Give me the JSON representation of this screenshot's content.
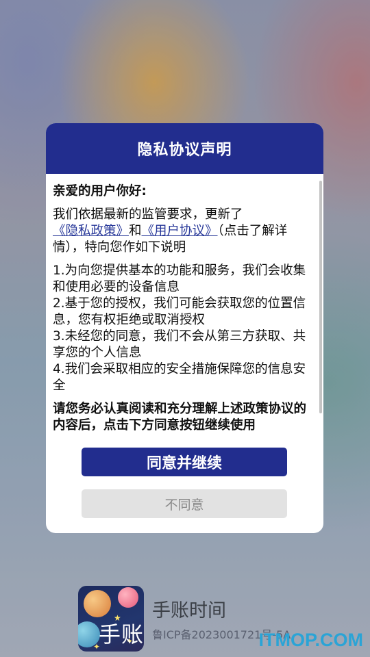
{
  "dialog": {
    "title": "隐私协议声明",
    "greeting": "亲爱的用户你好:",
    "intro_prefix": "我们依据最新的监管要求，更新了",
    "privacy_link": "《隐私政策》",
    "and": "和",
    "user_agreement_link": "《用户协议》",
    "intro_suffix": "（点击了解详情），特向您作如下说明",
    "points": [
      "1.为向您提供基本的功能和服务，我们会收集和使用必要的设备信息",
      " 2.基于您的授权，我们可能会获取您的位置信息，您有权拒绝或取消授权",
      " 3.未经您的同意，我们不会从第三方获取、共享您的个人信息",
      " 4.我们会采取相应的安全措施保障您的信息安全"
    ],
    "notice": "请您务必认真阅读和充分理解上述政策协议的内容后，点击下方同意按钮继续使用",
    "agree_label": "同意并继续",
    "disagree_label": "不同意"
  },
  "app": {
    "icon_text": "手账",
    "name": "手账时间",
    "icp": "鲁ICP备2023001721号-5A"
  },
  "watermark": "ITMOP.COM",
  "colors": {
    "primary": "#222d8e",
    "link": "#2a3a9a",
    "watermark": "#2aa4d6"
  }
}
